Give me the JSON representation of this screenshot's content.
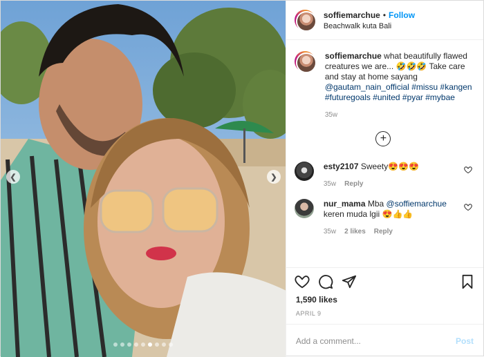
{
  "post": {
    "username": "soffiemarchue",
    "separator": "•",
    "follow_label": "Follow",
    "location": "Beachwalk kuta Bali"
  },
  "caption": {
    "username": "soffiemarchue",
    "text": " what beautifully flawed creatures we are... 🤣🤣🤣 Take care and stay at home sayang ",
    "mention": "@gautam_nain_official",
    "hashtags": " #missu #kangen #futuregoals #united #pyar #mybae",
    "time": "35w"
  },
  "comments": [
    {
      "username": "esty2107",
      "text": " Sweety😍😍😍",
      "mention": "",
      "text_after": "",
      "time": "35w",
      "likes": "",
      "reply": "Reply"
    },
    {
      "username": "nur_mama",
      "text": " Mba ",
      "mention": "@soffiemarchue",
      "text_after": " keren muda lgii 😍👍👍",
      "time": "35w",
      "likes": "2 likes",
      "reply": "Reply"
    }
  ],
  "likes_text": "1,590 likes",
  "date_text": "APRIL 9",
  "add_comment_placeholder": "Add a comment...",
  "post_button": "Post",
  "carousel": {
    "count": 9,
    "active_index": 5
  },
  "icons": {
    "nav_left": "chevron-left-icon",
    "nav_right": "chevron-right-icon",
    "like": "heart-icon",
    "comment": "comment-bubble-icon",
    "share": "paper-plane-icon",
    "save": "bookmark-icon",
    "load_more": "plus-circle-icon"
  },
  "colors": {
    "follow": "#0095f6",
    "link": "#00376b",
    "muted": "#8e8e8e",
    "post_disabled": "#b2dffc"
  }
}
